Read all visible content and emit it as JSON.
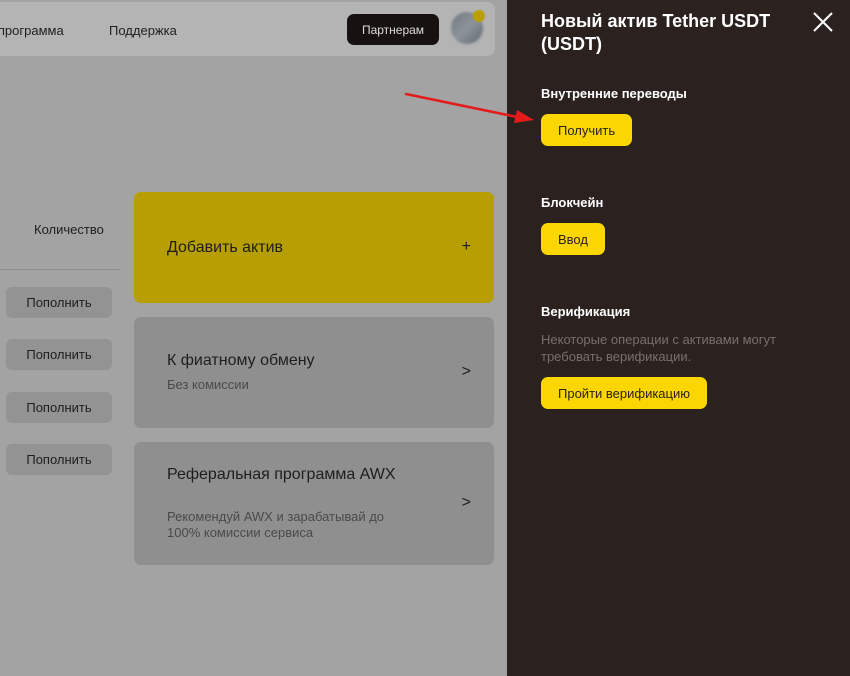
{
  "header": {
    "nav_referral": "ая программа",
    "nav_support": "Поддержка",
    "partners_button": "Партнерам"
  },
  "assets_table": {
    "quantity_header": "Количество",
    "deposit_buttons": [
      "Пополнить",
      "Пополнить",
      "Пополнить",
      "Пополнить"
    ]
  },
  "cards": {
    "add_asset": {
      "title": "Добавить актив",
      "action": "+"
    },
    "fiat_exchange": {
      "title": "К фиатному обмену",
      "subtitle": "Без комиссии",
      "action": ">"
    },
    "referral": {
      "title": "Реферальная программа AWX",
      "subtitle": "Рекомендуй AWX и зарабатывай до 100% комиссии сервиса",
      "action": ">"
    }
  },
  "drawer": {
    "title": "Новый актив Tether USDT (USDT)",
    "internal_transfers": {
      "heading": "Внутренние переводы",
      "receive_button": "Получить"
    },
    "blockchain": {
      "heading": "Блокчейн",
      "deposit_button": "Ввод"
    },
    "verification": {
      "heading": "Верификация",
      "text": "Некоторые операции с активами могут требовать верификации.",
      "button": "Пройти верификацию"
    }
  },
  "colors": {
    "accent_yellow": "#fcd601",
    "drawer_background": "#2b2220",
    "annotation_arrow": "#e31b1b"
  }
}
